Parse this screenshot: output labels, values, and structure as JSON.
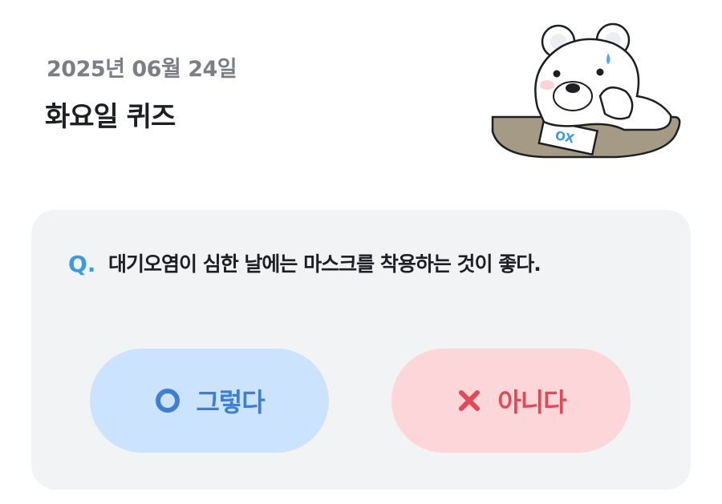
{
  "header": {
    "date": "2025년 06월 24일",
    "title": "화요일 퀴즈"
  },
  "mascot": {
    "icon": "polar-bear-mascot-icon",
    "paper_text": "OX"
  },
  "quiz": {
    "q_mark": "Q.",
    "question": "대기오염이 심한 날에는 마스크를 착용하는 것이 좋다.",
    "answers": {
      "yes": {
        "label": "그렇다",
        "icon": "circle-o-icon",
        "color": "#3f7fd2",
        "bg": "#cce3fd"
      },
      "no": {
        "label": "아니다",
        "icon": "cross-x-icon",
        "color": "#e04a57",
        "bg": "#fdd6da"
      }
    }
  }
}
